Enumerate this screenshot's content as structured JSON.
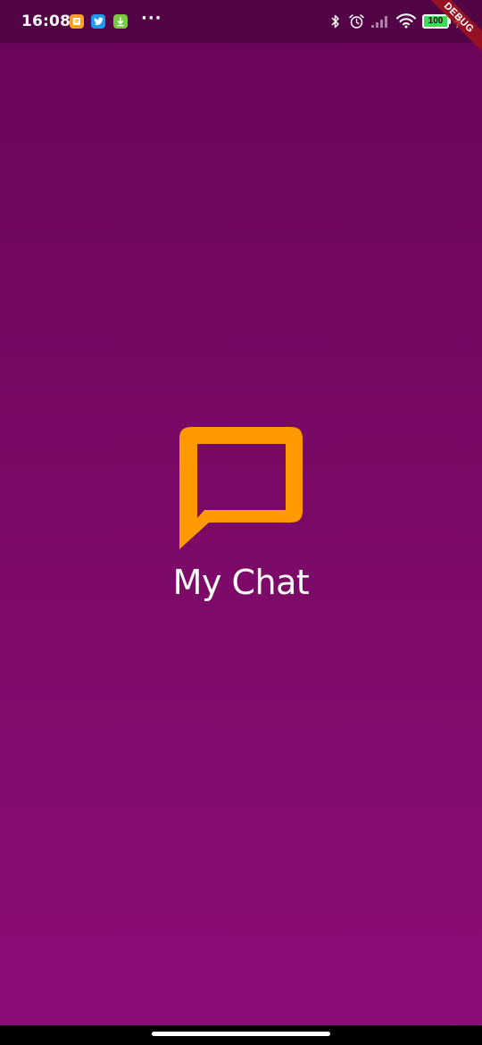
{
  "status_bar": {
    "time": "16:08",
    "notification_icons": [
      "note-app-icon",
      "twitter-icon",
      "download-icon"
    ],
    "overflow": "···",
    "system_icons": [
      "bluetooth-icon",
      "alarm-icon",
      "cell-signal-icon",
      "wifi-icon"
    ],
    "battery_level": "100",
    "battery_percent": 100,
    "charging_icon": "bolt-icon"
  },
  "debug_banner": {
    "label": "DEBUG"
  },
  "splash": {
    "logo_icon": "chat-bubble-icon",
    "title": "My Chat"
  },
  "colors": {
    "background_top": "#690659",
    "background_bottom": "#8e0d77",
    "logo": "#ff9900",
    "text": "#ffffff",
    "debug": "#a0141e"
  }
}
